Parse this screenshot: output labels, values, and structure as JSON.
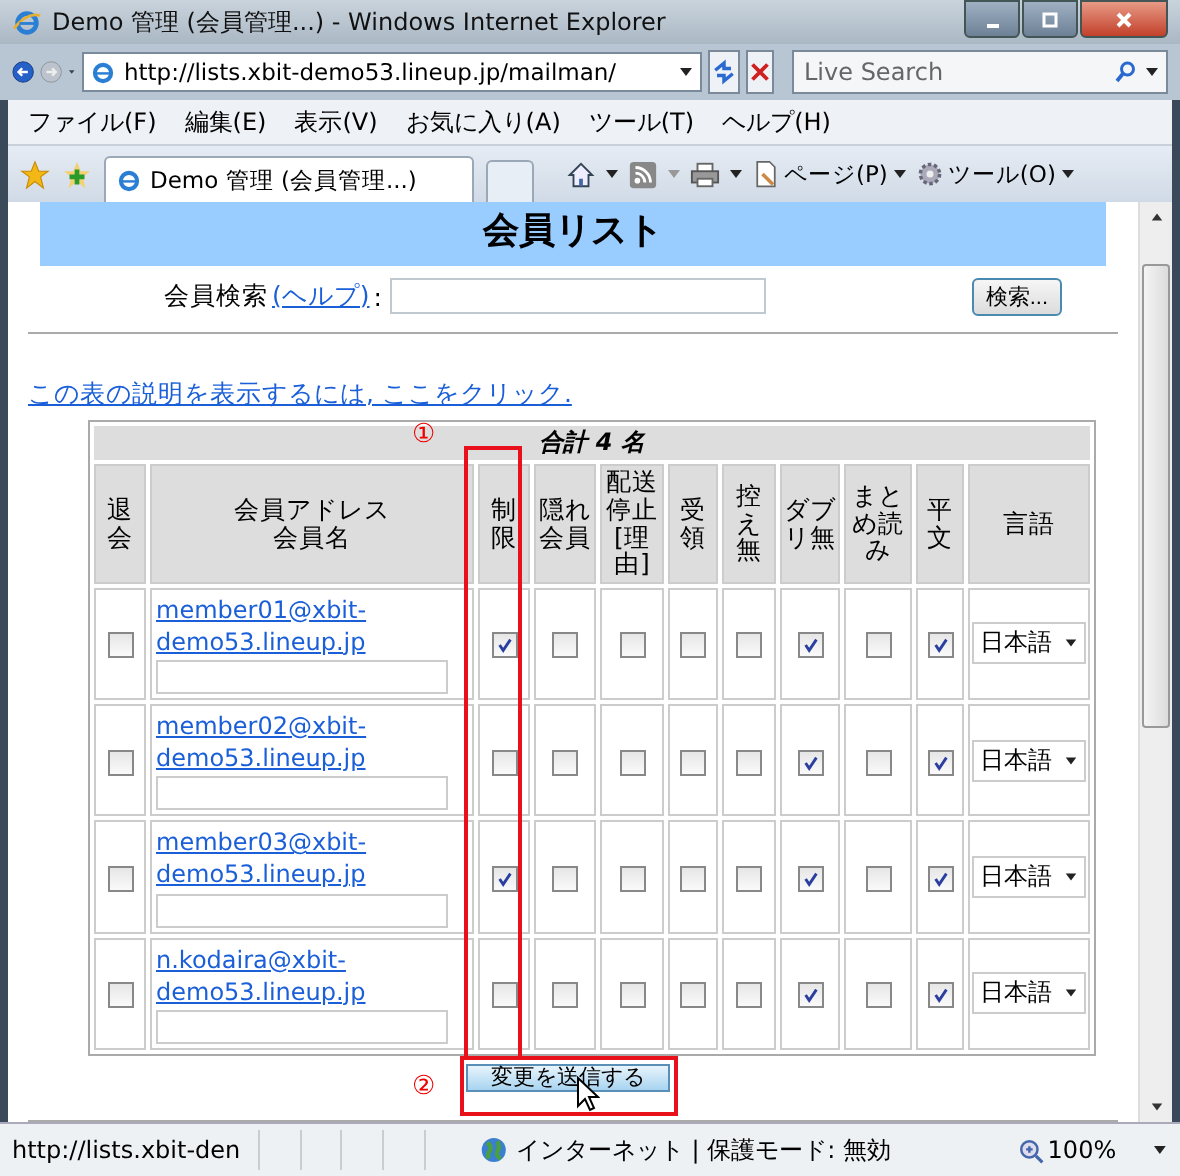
{
  "window": {
    "title": "Demo 管理 (会員管理...) - Windows Internet Explorer"
  },
  "address_bar": {
    "url": "http://lists.xbit-demo53.lineup.jp/mailman/"
  },
  "search_box": {
    "placeholder": "Live Search"
  },
  "menu": [
    "ファイル(F)",
    "編集(E)",
    "表示(V)",
    "お気に入り(A)",
    "ツール(T)",
    "ヘルプ(H)"
  ],
  "tab": {
    "title": "Demo 管理 (会員管理...)"
  },
  "command_bar": [
    "ページ(P)",
    "ツール(O)"
  ],
  "page": {
    "heading": "会員リスト",
    "search_label": "会員検索",
    "help_link": "(ヘルプ)",
    "search_suffix": ":",
    "search_button": "検索...",
    "info_link": "この表の説明を表示するには, ここをクリック.",
    "table": {
      "caption": "合計 4 名",
      "columns": [
        {
          "kind": "check",
          "label": "退会"
        },
        {
          "kind": "address",
          "label": "会員アドレス",
          "sublabel": "会員名"
        },
        {
          "kind": "check",
          "label": "制限"
        },
        {
          "kind": "check",
          "label": "隠れ会員"
        },
        {
          "kind": "check",
          "label": "配送停止[理由]"
        },
        {
          "kind": "check",
          "label": "受領"
        },
        {
          "kind": "check",
          "label": "控え無"
        },
        {
          "kind": "check",
          "label": "ダブリ無"
        },
        {
          "kind": "check",
          "label": "まとめ読み"
        },
        {
          "kind": "check",
          "label": "平文"
        },
        {
          "kind": "language",
          "label": "言語"
        }
      ],
      "rows": [
        {
          "address": "member01@xbit-demo53.lineup.jp",
          "checks": [
            false,
            true,
            false,
            false,
            false,
            false,
            true,
            false,
            true
          ],
          "language": "日本語"
        },
        {
          "address": "member02@xbit-demo53.lineup.jp",
          "checks": [
            false,
            false,
            false,
            false,
            false,
            false,
            true,
            false,
            true
          ],
          "language": "日本語"
        },
        {
          "address": "member03@xbit-demo53.lineup.jp",
          "checks": [
            false,
            true,
            false,
            false,
            false,
            false,
            true,
            false,
            true
          ],
          "language": "日本語"
        },
        {
          "address": "n.kodaira@xbit-demo53.lineup.jp",
          "checks": [
            false,
            false,
            false,
            false,
            false,
            false,
            true,
            false,
            true
          ],
          "language": "日本語"
        }
      ]
    },
    "submit_button": "変更を送信する",
    "annotations": [
      {
        "label": "①"
      },
      {
        "label": "②"
      }
    ]
  },
  "status_bar": {
    "url": "http://lists.xbit-den",
    "zone": "インターネット | 保護モード: 無効",
    "zoom": "100%"
  }
}
